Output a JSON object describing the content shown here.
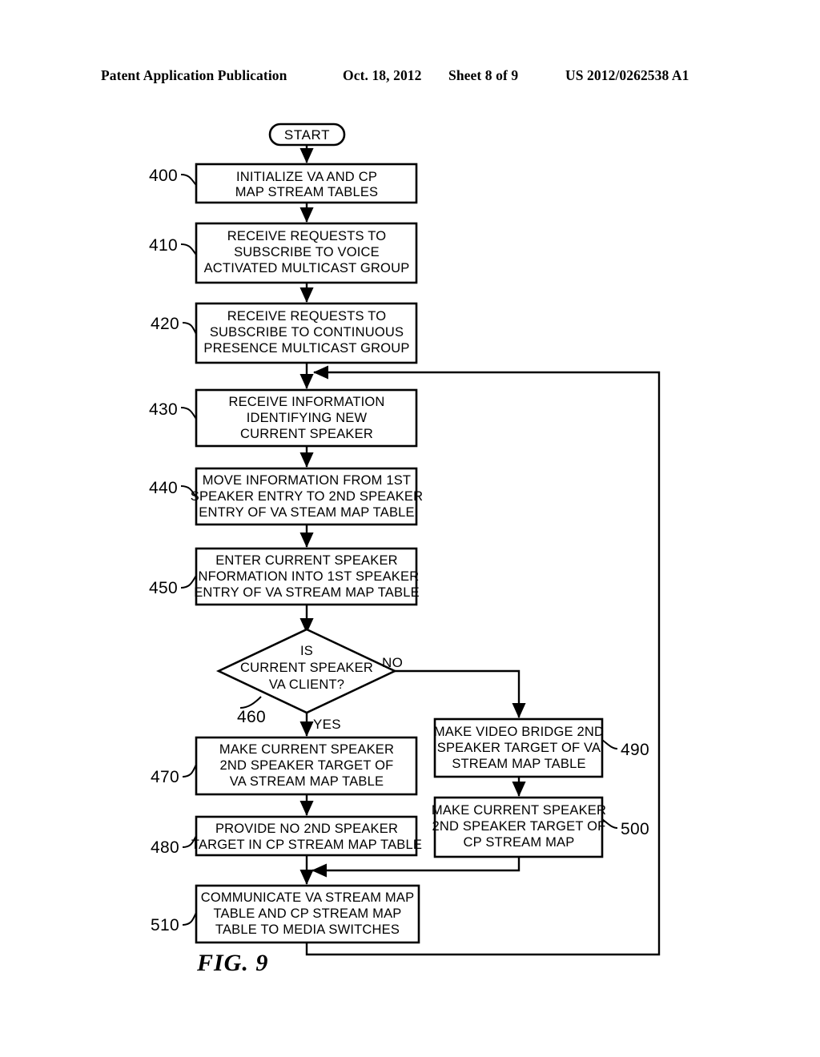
{
  "header": {
    "publication": "Patent Application Publication",
    "date": "Oct. 18, 2012",
    "sheet": "Sheet 8 of 9",
    "patent_number": "US 2012/0262538 A1"
  },
  "figure": {
    "label": "FIG. 9"
  },
  "flowchart": {
    "start_label": "START",
    "nodes": [
      {
        "ref": "400",
        "type": "process",
        "lines": [
          "INITIALIZE VA AND CP",
          "MAP STREAM TABLES"
        ]
      },
      {
        "ref": "410",
        "type": "process",
        "lines": [
          "RECEIVE REQUESTS TO",
          "SUBSCRIBE TO VOICE",
          "ACTIVATED MULTICAST GROUP"
        ]
      },
      {
        "ref": "420",
        "type": "process",
        "lines": [
          "RECEIVE REQUESTS TO",
          "SUBSCRIBE TO CONTINUOUS",
          "PRESENCE MULTICAST GROUP"
        ]
      },
      {
        "ref": "430",
        "type": "process",
        "lines": [
          "RECEIVE INFORMATION",
          "IDENTIFYING NEW",
          "CURRENT SPEAKER"
        ]
      },
      {
        "ref": "440",
        "type": "process",
        "lines": [
          "MOVE INFORMATION FROM 1ST",
          "SPEAKER ENTRY TO 2ND SPEAKER",
          "ENTRY OF VA STEAM MAP TABLE"
        ]
      },
      {
        "ref": "450",
        "type": "process",
        "lines": [
          "ENTER CURRENT SPEAKER",
          "INFORMATION INTO 1ST SPEAKER",
          "ENTRY OF VA STREAM MAP TABLE"
        ]
      },
      {
        "ref": "460",
        "type": "decision",
        "lines": [
          "IS",
          "CURRENT SPEAKER",
          "VA CLIENT?"
        ]
      },
      {
        "ref": "470",
        "type": "process",
        "lines": [
          "MAKE CURRENT SPEAKER",
          "2ND SPEAKER TARGET OF",
          "VA STREAM MAP TABLE"
        ]
      },
      {
        "ref": "480",
        "type": "process",
        "lines": [
          "PROVIDE NO 2ND SPEAKER",
          "TARGET IN CP STREAM MAP TABLE"
        ]
      },
      {
        "ref": "490",
        "type": "process",
        "lines": [
          "MAKE VIDEO BRIDGE 2ND",
          "SPEAKER TARGET OF VA",
          "STREAM MAP TABLE"
        ]
      },
      {
        "ref": "500",
        "type": "process",
        "lines": [
          "MAKE CURRENT SPEAKER",
          "2ND SPEAKER TARGET OF",
          "CP STREAM MAP"
        ]
      },
      {
        "ref": "510",
        "type": "process",
        "lines": [
          "COMMUNICATE VA STREAM MAP",
          "TABLE AND CP STREAM MAP",
          "TABLE TO MEDIA SWITCHES"
        ]
      }
    ],
    "branch_labels": {
      "yes": "YES",
      "no": "NO"
    }
  }
}
